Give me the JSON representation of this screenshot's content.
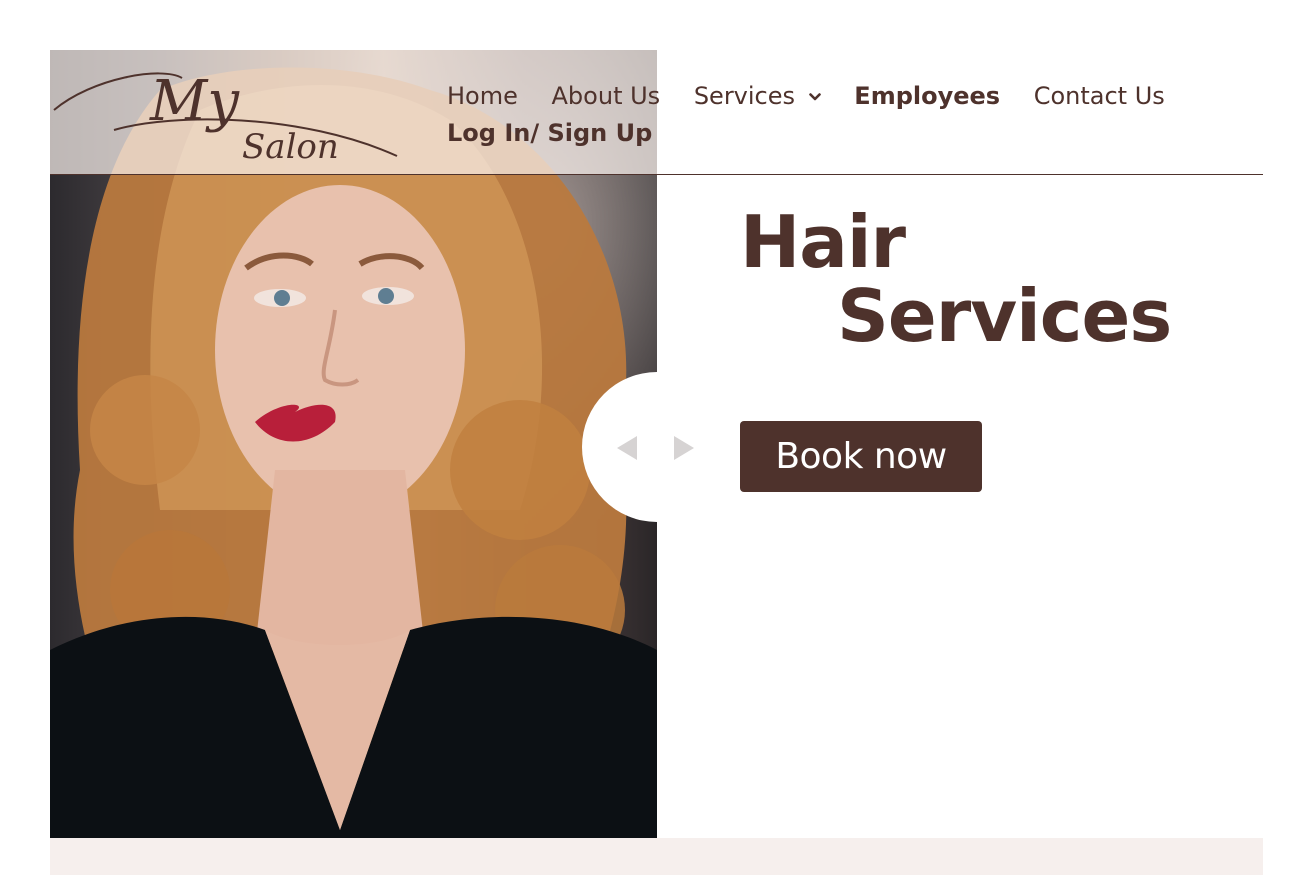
{
  "brand": {
    "logo_text_line1": "My",
    "logo_text_line2": "Salon",
    "color_text": "#4e322c",
    "color_overlay": "#f8f0ec"
  },
  "nav": {
    "items": [
      {
        "label": "Home",
        "bold": false
      },
      {
        "label": "About Us",
        "bold": false
      },
      {
        "label": "Services",
        "bold": false,
        "dropdown": true
      },
      {
        "label": "Employees",
        "bold": true
      },
      {
        "label": "Contact Us",
        "bold": false
      },
      {
        "label": "Log In/ Sign Up",
        "bold": true
      }
    ],
    "dropdown_icon": "chevron-down-icon"
  },
  "hero": {
    "title_line1": "Hair",
    "title_line2": "Services",
    "cta_label": "Book now",
    "prev_icon": "triangle-left-icon",
    "next_icon": "triangle-right-icon"
  }
}
